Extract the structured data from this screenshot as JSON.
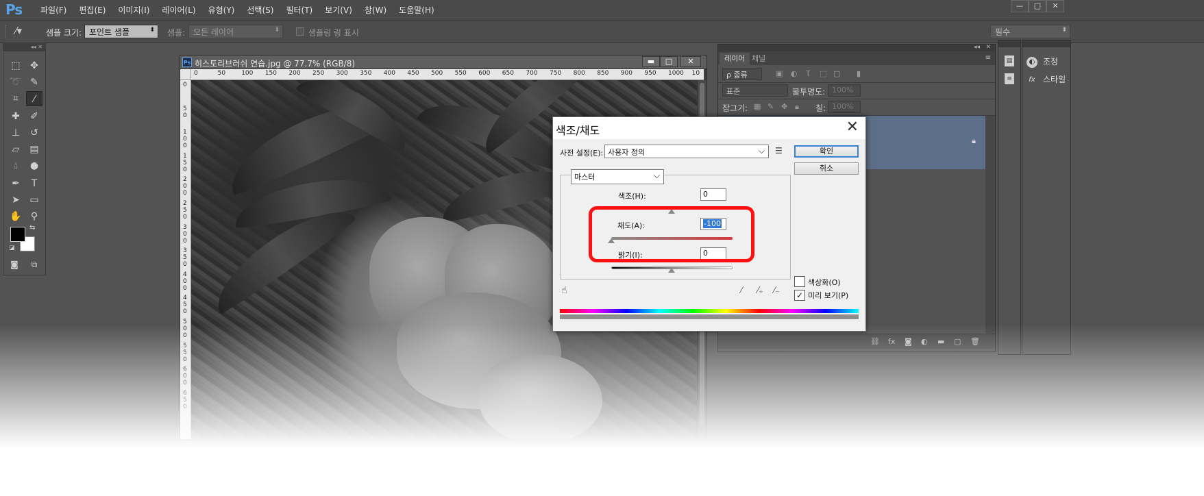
{
  "app": {
    "logo": "Ps"
  },
  "menu": [
    "파일(F)",
    "편집(E)",
    "이미지(I)",
    "레이어(L)",
    "유형(Y)",
    "선택(S)",
    "필터(T)",
    "보기(V)",
    "창(W)",
    "도움말(H)"
  ],
  "window_controls": {
    "minimize": "—",
    "restore": "□",
    "close": "✕"
  },
  "options": {
    "sample_size_label": "샘플 크기:",
    "sample_size_value": "포인트 샘플",
    "sample_label": "샘플:",
    "sample_value": "모든 레이어",
    "show_ring_label": "샘플링 링 표시",
    "workspace_value": "필수"
  },
  "document": {
    "title": "히스토리브러쉬 연습.jpg @ 77.7% (RGB/8)",
    "ruler_h": [
      "0",
      "50",
      "100",
      "150",
      "200",
      "250",
      "300",
      "350",
      "400",
      "450",
      "500",
      "550",
      "600",
      "650",
      "700",
      "750",
      "800",
      "850",
      "900",
      "950",
      "1000",
      "10"
    ],
    "ruler_v": [
      "0",
      "50",
      "100",
      "150",
      "200",
      "250",
      "300",
      "350",
      "400",
      "450",
      "500",
      "550",
      "600",
      "650"
    ]
  },
  "layers_panel": {
    "tabs": [
      "레이어",
      "채널"
    ],
    "kind_filter": "ρ 종류",
    "blend_mode": "표준",
    "opacity_label": "불투명도:",
    "opacity_value": "100%",
    "lock_label": "잠그기:",
    "fill_label": "칠:",
    "fill_value": "100%"
  },
  "right_panels": {
    "adjust_label": "조정",
    "style_label": "스타일"
  },
  "dialog": {
    "title": "색조/채도",
    "preset_label": "사전 설정(E):",
    "preset_value": "사용자 정의",
    "ok_label": "확인",
    "cancel_label": "취소",
    "channel_value": "마스터",
    "hue_label": "색조(H):",
    "hue_value": "0",
    "saturation_label": "채도(A):",
    "saturation_value": "-100",
    "lightness_label": "밝기(I):",
    "lightness_value": "0",
    "colorize_label": "색상화(O)",
    "preview_label": "미리 보기(P)",
    "preview_checked": true,
    "colorize_checked": false,
    "highlight_color": "#ff1010"
  }
}
